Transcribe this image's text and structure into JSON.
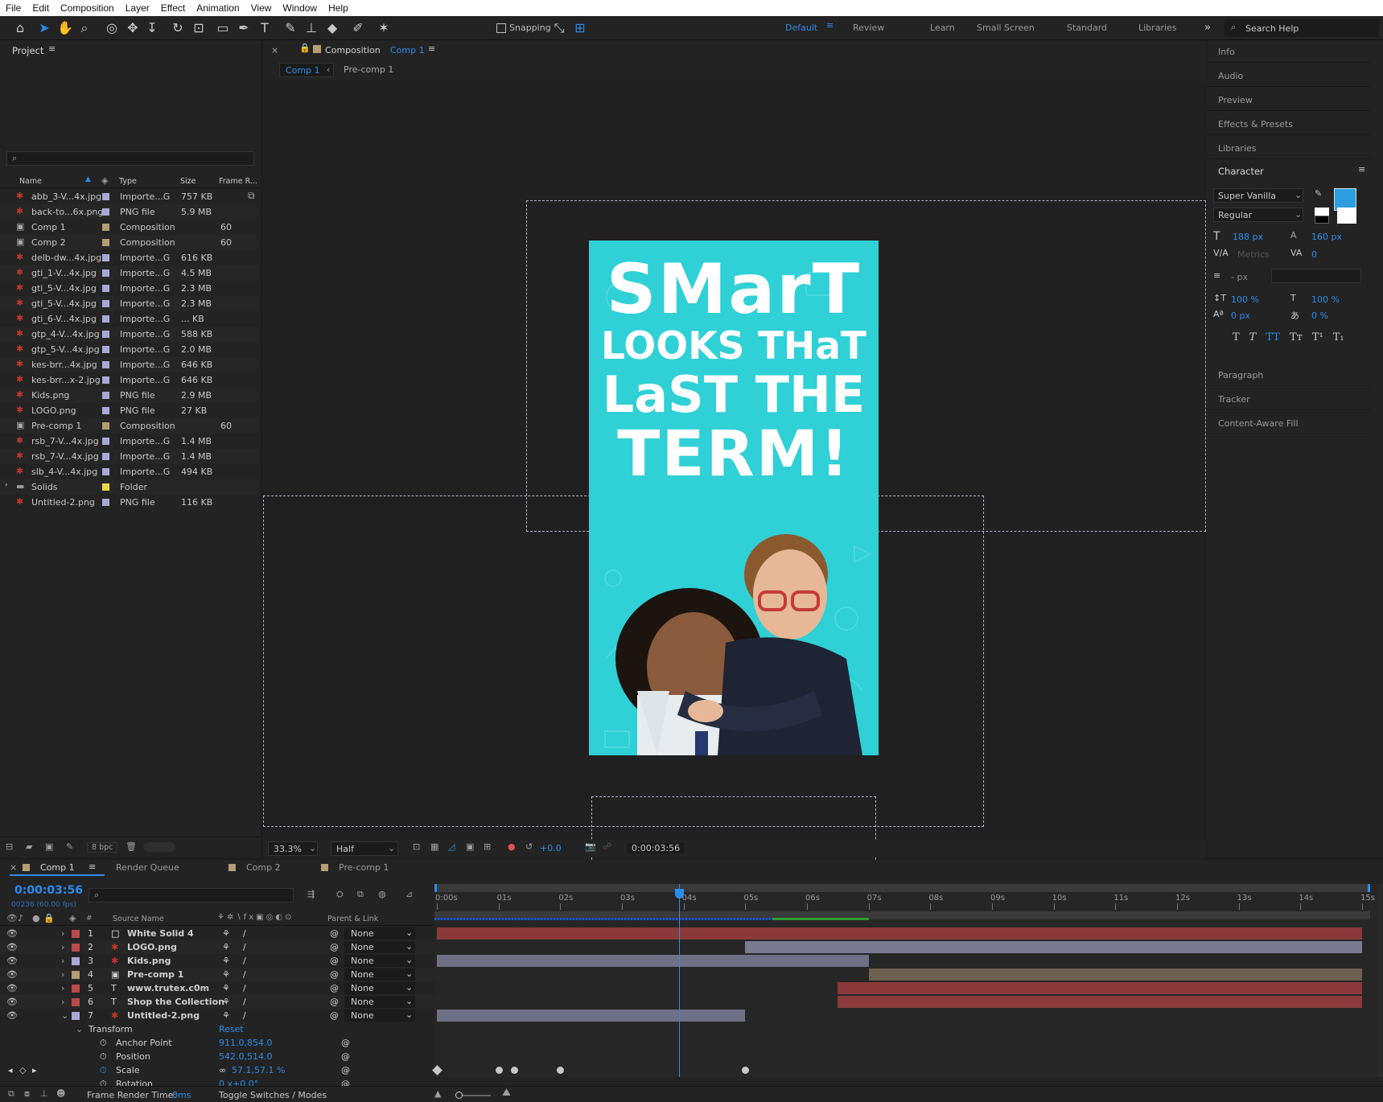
{
  "menu": [
    "File",
    "Edit",
    "Composition",
    "Layer",
    "Effect",
    "Animation",
    "View",
    "Window",
    "Help"
  ],
  "toolbar": {
    "snapping": "Snapping",
    "workspaces": [
      "Default",
      "Review",
      "Learn",
      "Small Screen",
      "Standard",
      "Libraries"
    ],
    "active_workspace": "Default",
    "search_placeholder": "Search Help"
  },
  "project": {
    "title": "Project",
    "columns": [
      "Name",
      "Type",
      "Size",
      "Frame R..."
    ],
    "items": [
      {
        "name": "abb_3-V...4x.jpg",
        "type": "Importe...G",
        "size": "757 KB",
        "fr": "",
        "icon": "image",
        "color": "#a9a9d8"
      },
      {
        "name": "back-to...6x.png",
        "type": "PNG file",
        "size": "5.9 MB",
        "fr": "",
        "icon": "image",
        "color": "#a9a9d8"
      },
      {
        "name": "Comp 1",
        "type": "Composition",
        "size": "",
        "fr": "60",
        "icon": "comp",
        "color": "#b59d74"
      },
      {
        "name": "Comp 2",
        "type": "Composition",
        "size": "",
        "fr": "60",
        "icon": "comp",
        "color": "#b59d74"
      },
      {
        "name": "delb-dw...4x.jpg",
        "type": "Importe...G",
        "size": "616 KB",
        "fr": "",
        "icon": "image",
        "color": "#a9a9d8"
      },
      {
        "name": "gti_1-V...4x.jpg",
        "type": "Importe...G",
        "size": "4.5 MB",
        "fr": "",
        "icon": "image",
        "color": "#a9a9d8"
      },
      {
        "name": "gti_5-V...4x.jpg",
        "type": "Importe...G",
        "size": "2.3 MB",
        "fr": "",
        "icon": "image",
        "color": "#a9a9d8"
      },
      {
        "name": "gti_5-V...4x.jpg",
        "type": "Importe...G",
        "size": "2.3 MB",
        "fr": "",
        "icon": "image",
        "color": "#a9a9d8"
      },
      {
        "name": "gti_6-V...4x.jpg",
        "type": "Importe...G",
        "size": "... KB",
        "fr": "",
        "icon": "image",
        "color": "#a9a9d8"
      },
      {
        "name": "gtp_4-V...4x.jpg",
        "type": "Importe...G",
        "size": "588 KB",
        "fr": "",
        "icon": "image",
        "color": "#a9a9d8"
      },
      {
        "name": "gtp_5-V...4x.jpg",
        "type": "Importe...G",
        "size": "2.0 MB",
        "fr": "",
        "icon": "image",
        "color": "#a9a9d8"
      },
      {
        "name": "kes-brr...4x.jpg",
        "type": "Importe...G",
        "size": "646 KB",
        "fr": "",
        "icon": "image",
        "color": "#a9a9d8"
      },
      {
        "name": "kes-brr...x-2.jpg",
        "type": "Importe...G",
        "size": "646 KB",
        "fr": "",
        "icon": "image",
        "color": "#a9a9d8"
      },
      {
        "name": "Kids.png",
        "type": "PNG file",
        "size": "2.9 MB",
        "fr": "",
        "icon": "image",
        "color": "#a9a9d8"
      },
      {
        "name": "LOGO.png",
        "type": "PNG file",
        "size": "27 KB",
        "fr": "",
        "icon": "image",
        "color": "#a9a9d8"
      },
      {
        "name": "Pre-comp 1",
        "type": "Composition",
        "size": "",
        "fr": "60",
        "icon": "comp",
        "color": "#b59d74"
      },
      {
        "name": "rsb_7-V...4x.jpg",
        "type": "Importe...G",
        "size": "1.4 MB",
        "fr": "",
        "icon": "image",
        "color": "#a9a9d8"
      },
      {
        "name": "rsb_7-V...4x.jpg",
        "type": "Importe...G",
        "size": "1.4 MB",
        "fr": "",
        "icon": "image",
        "color": "#a9a9d8"
      },
      {
        "name": "slb_4-V...4x.jpg",
        "type": "Importe...G",
        "size": "494 KB",
        "fr": "",
        "icon": "image",
        "color": "#a9a9d8"
      },
      {
        "name": "Solids",
        "type": "Folder",
        "size": "",
        "fr": "",
        "icon": "folder",
        "color": "#e7d84d"
      },
      {
        "name": "Untitled-2.png",
        "type": "PNG file",
        "size": "116 KB",
        "fr": "",
        "icon": "image",
        "color": "#a9a9d8"
      }
    ],
    "bpc": "8 bpc"
  },
  "composition": {
    "panel_label": "Composition",
    "comp_name": "Comp 1",
    "tabs": [
      "Comp 1",
      "Pre-comp 1"
    ],
    "zoom": "33.3%",
    "resolution": "Half",
    "exposure": "+0.0",
    "timecode": "0:00:03:56",
    "poster": {
      "line1": "SMarT",
      "line2": "LOOKS THaT",
      "line3": "LaST THE",
      "line4": "TERM!",
      "bg": "#2fd0d6"
    }
  },
  "right_panels": {
    "top": [
      "Info",
      "Audio",
      "Preview",
      "Effects & Presets",
      "Libraries"
    ],
    "character": {
      "title": "Character",
      "font": "Super Vanilla",
      "style": "Regular",
      "size": "188 px",
      "leading": "160 px",
      "kerning": "Metrics",
      "tracking": "0",
      "stroke": "- px",
      "vscale": "100 %",
      "hscale": "100 %",
      "baseline": "0 px",
      "tsume": "0 %",
      "fill": "#2d9fe0"
    },
    "bottom": [
      "Paragraph",
      "Tracker",
      "Content-Aware Fill"
    ]
  },
  "timeline": {
    "tabs": [
      "Comp 1",
      "Render Queue",
      "Comp 2",
      "Pre-comp 1"
    ],
    "timecode": "0:00:03:56",
    "frames": "00236 (60.00 fps)",
    "headers": {
      "source": "Source Name",
      "parent": "Parent & Link"
    },
    "ruler": [
      "0:00s",
      "01s",
      "02s",
      "03s",
      "04s",
      "05s",
      "06s",
      "07s",
      "08s",
      "09s",
      "10s",
      "11s",
      "12s",
      "13s",
      "14s",
      "15s"
    ],
    "current_time_s": 3.93,
    "duration_s": 15,
    "layers": [
      {
        "num": "1",
        "name": "White Solid 4",
        "icon": "solid",
        "label": "#b94a4a",
        "parent": "None",
        "start": 0,
        "end": 15,
        "color": "#8a3a3a"
      },
      {
        "num": "2",
        "name": "LOGO.png",
        "icon": "image",
        "label": "#b94a4a",
        "parent": "None",
        "start": 5,
        "end": 15,
        "color": "#7a7a90"
      },
      {
        "num": "3",
        "name": "Kids.png",
        "icon": "image",
        "label": "#a9a9d8",
        "parent": "None",
        "start": 0,
        "end": 7,
        "color": "#6f6f85"
      },
      {
        "num": "4",
        "name": "Pre-comp 1",
        "icon": "comp",
        "label": "#b59d74",
        "parent": "None",
        "start": 7,
        "end": 15,
        "color": "#6e6050"
      },
      {
        "num": "5",
        "name": "www.trutex.c0m",
        "icon": "text",
        "label": "#b94a4a",
        "parent": "None",
        "start": 6.5,
        "end": 15,
        "color": "#8a3a3a"
      },
      {
        "num": "6",
        "name": "Shop the Collection",
        "icon": "text",
        "label": "#b94a4a",
        "parent": "None",
        "start": 6.5,
        "end": 15,
        "color": "#8a3a3a"
      },
      {
        "num": "7",
        "name": "Untitled-2.png",
        "icon": "image",
        "label": "#a9a9d8",
        "parent": "None",
        "start": 0,
        "end": 5,
        "color": "#6f6f85"
      }
    ],
    "transform": {
      "label": "Transform",
      "reset": "Reset",
      "props": [
        {
          "name": "Anchor Point",
          "value": "911.0,854.0"
        },
        {
          "name": "Position",
          "value": "542.0,514.0"
        },
        {
          "name": "Scale",
          "value": "57.1,57.1 %"
        },
        {
          "name": "Rotation",
          "value": "0 x+0.0°"
        }
      ]
    },
    "scale_keyframes_s": [
      0,
      1,
      1.25,
      2,
      5
    ],
    "footer": {
      "render_label": "Frame Render Time:",
      "render_value": "0ms",
      "toggle": "Toggle Switches / Modes"
    }
  }
}
